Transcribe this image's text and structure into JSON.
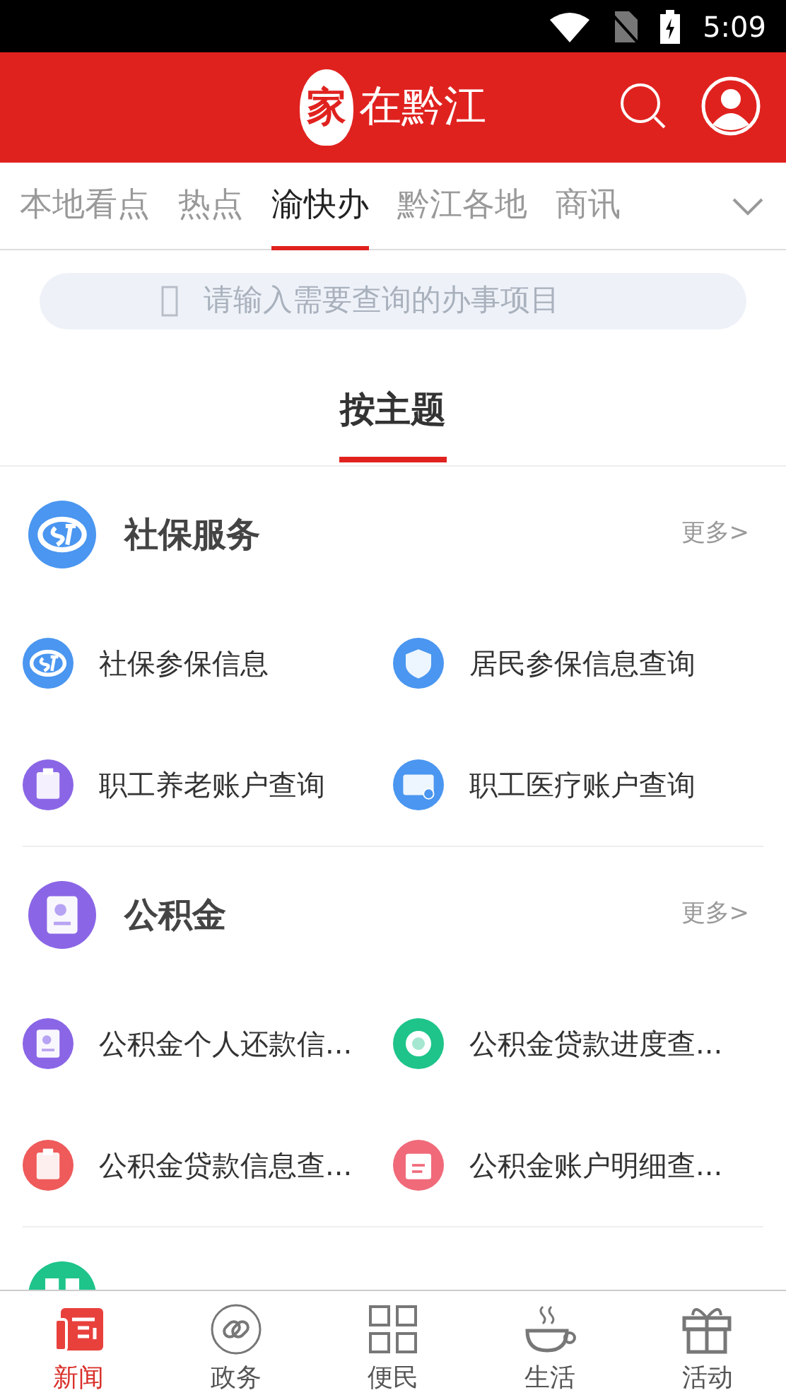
{
  "status_bar": {
    "time": "5:09"
  },
  "header": {
    "logo_seal": "家",
    "logo_text": "在黔江"
  },
  "tabs": [
    {
      "label": "本地看点",
      "selected": false
    },
    {
      "label": "热点",
      "selected": false
    },
    {
      "label": "渝快办",
      "selected": true
    },
    {
      "label": "黔江各地",
      "selected": false
    },
    {
      "label": "商讯",
      "selected": false
    }
  ],
  "search": {
    "placeholder": "请输入需要查询的办事项目"
  },
  "heading": "按主题",
  "sections": [
    {
      "title": "社保服务",
      "more": "更多>",
      "icon": {
        "kind": "si",
        "color": "#4a96f0"
      },
      "items": [
        {
          "label": "社保参保信息",
          "kind": "si",
          "color": "#4a96f0"
        },
        {
          "label": "居民参保信息查询",
          "kind": "shield",
          "color": "#4a96f0"
        },
        {
          "label": "职工养老账户查询",
          "kind": "clipboard",
          "color": "#8a66e6"
        },
        {
          "label": "职工医疗账户查询",
          "kind": "card",
          "color": "#4a96f0"
        }
      ]
    },
    {
      "title": "公积金",
      "more": "更多>",
      "icon": {
        "kind": "doc",
        "color": "#8a66e6"
      },
      "items": [
        {
          "label": "公积金个人还款信...",
          "kind": "doc",
          "color": "#8a66e6"
        },
        {
          "label": "公积金贷款进度查...",
          "kind": "loan",
          "color": "#1ec48a"
        },
        {
          "label": "公积金贷款信息查...",
          "kind": "clipboard",
          "color": "#ef5a5a"
        },
        {
          "label": "公积金账户明细查...",
          "kind": "clipdoc",
          "color": "#f06a7a"
        }
      ]
    },
    {
      "icon": {
        "kind": "grid",
        "color": "#1ec48a"
      }
    }
  ],
  "bottom_nav": [
    {
      "label": "新闻",
      "kind": "news",
      "selected": true
    },
    {
      "label": "政务",
      "kind": "link",
      "selected": false
    },
    {
      "label": "便民",
      "kind": "grid",
      "selected": false
    },
    {
      "label": "生活",
      "kind": "cup",
      "selected": false
    },
    {
      "label": "活动",
      "kind": "gift",
      "selected": false
    }
  ]
}
